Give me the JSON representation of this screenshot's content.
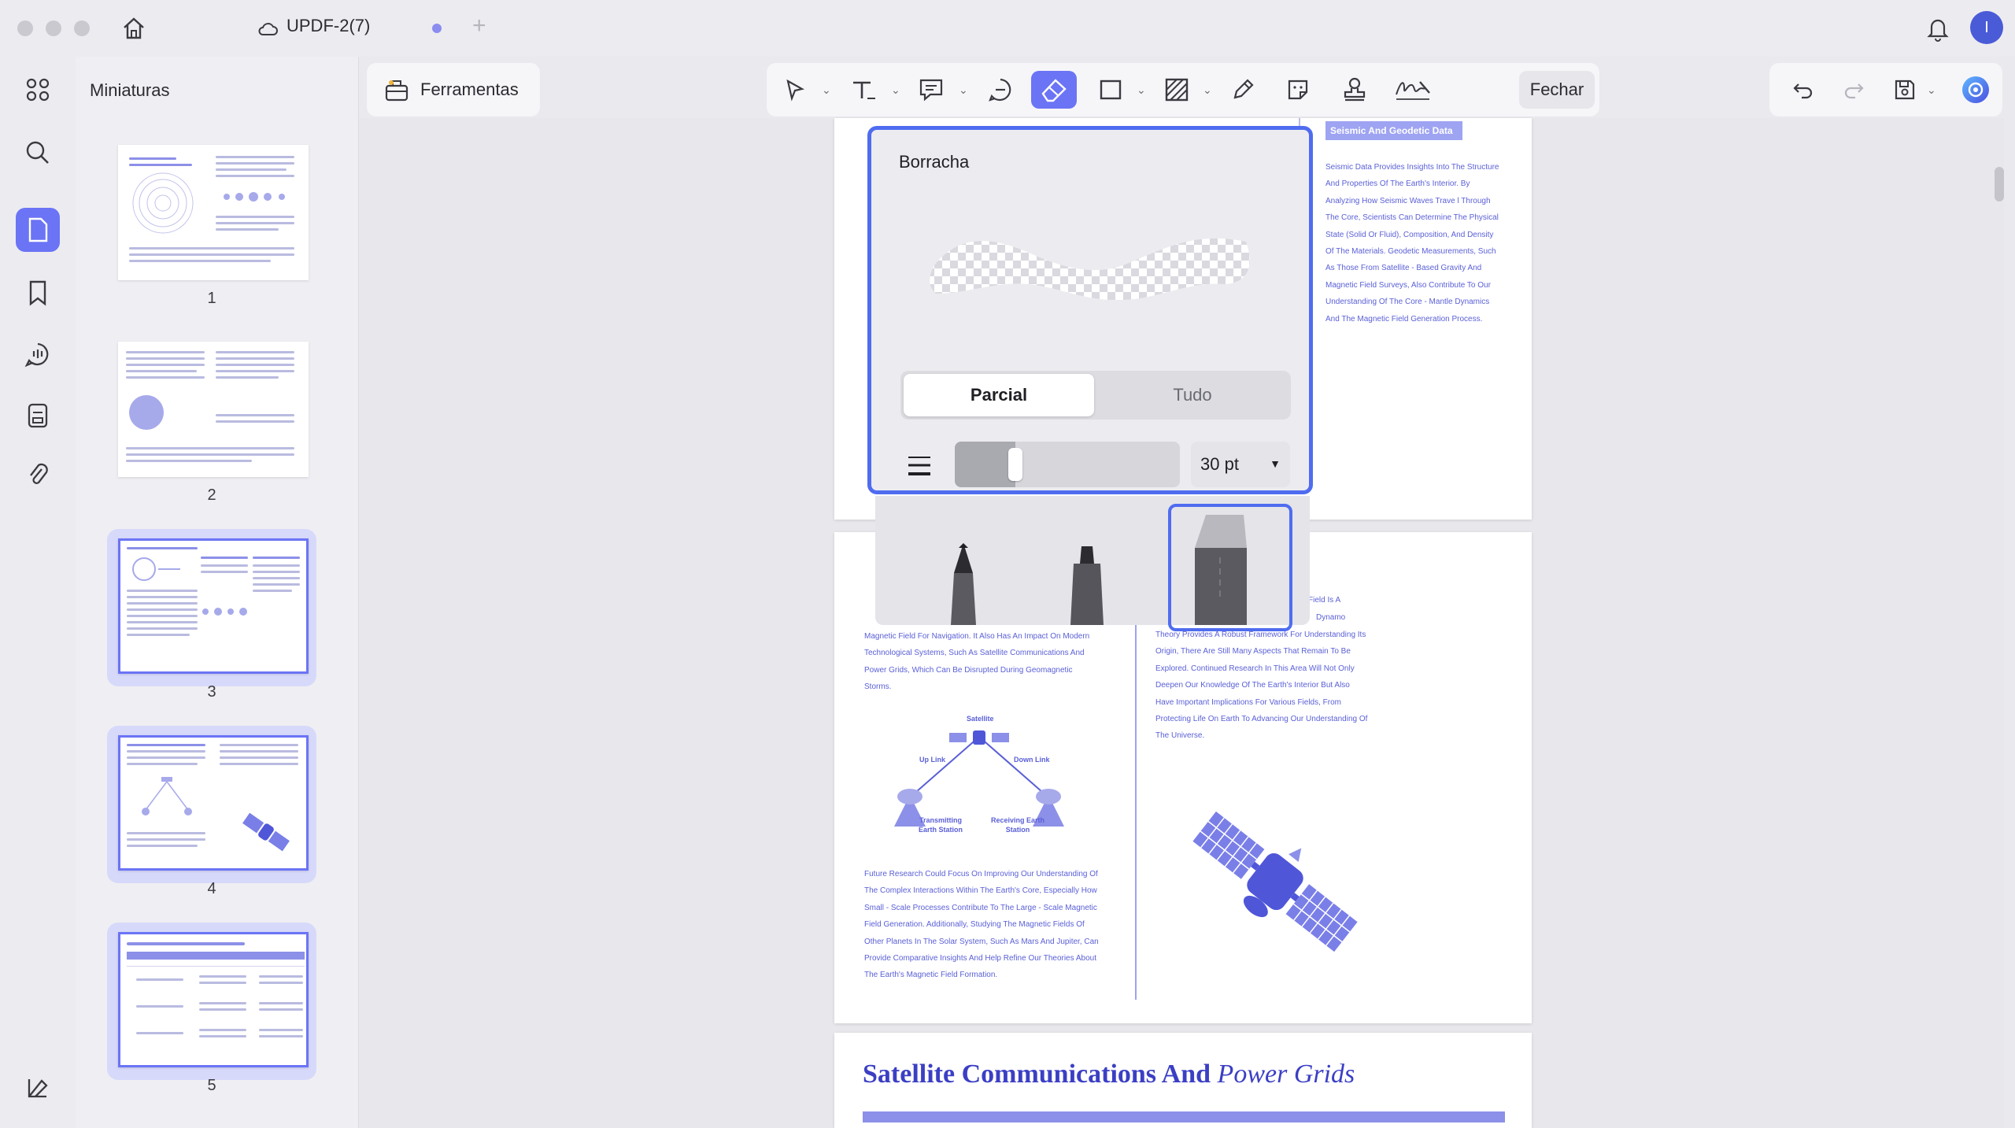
{
  "window": {
    "title": "UPDF-2(7)",
    "new_tab": "+",
    "user_initial": "I"
  },
  "sidebar": {
    "title": "Miniaturas",
    "rail_icons": [
      "thumbnails-grid-icon",
      "search-icon",
      "pages-icon",
      "bookmark-icon",
      "comment-icon",
      "form-icon",
      "attachment-icon",
      "layers-icon"
    ],
    "pages": [
      {
        "number": "1"
      },
      {
        "number": "2"
      },
      {
        "number": "3"
      },
      {
        "number": "4"
      },
      {
        "number": "5"
      }
    ]
  },
  "toolbar": {
    "tools_label": "Ferramentas",
    "close_label": "Fechar",
    "icons": [
      "cursor-icon",
      "text-icon",
      "text-comment-icon",
      "note-icon",
      "eraser-icon",
      "rectangle-icon",
      "hatch-icon",
      "pencil-icon",
      "sticker-icon",
      "stamp-icon",
      "signature-icon"
    ]
  },
  "eraser_popup": {
    "title": "Borracha",
    "mode_partial": "Parcial",
    "mode_all": "Tudo",
    "size": "30 pt",
    "size_fraction": 0.27,
    "tray_icons": [
      "pen-icon",
      "marker-icon",
      "eraser-tool-icon"
    ]
  },
  "document": {
    "seismic_badge": "Seismic And Geodetic Data",
    "seismic_text": "Seismic Data Provides Insights Into The Structure And Properties Of The Earth's Interior. By Analyzing How Seismic Waves Trave l Through The Core, Scientists Can Determine The Physical State (Solid Or Fluid), Composition, And Density Of The Materials. Geodetic Measurements, Such As Those From Satellite - Based Gravity And Magnetic Field Surveys, Also Contribute To Our Understanding Of The Core - Mantle Dynamics And The Magnetic Field Generation Process.",
    "left_col_top": "Magnetic Field For Navigation. It Also Has An Impact On Modern Technological Systems, Such As Satellite Communications And Power Grids, Which Can Be Disrupted During Geomagnetic Storms.",
    "right_col_top_a": "Field Is A",
    "right_col_top_b": "Dynamo",
    "right_col_text": "Theory Provides A Robust Framework For Understanding Its Origin, There Are Still Many Aspects That Remain To Be Explored. Continued Research In This Area Will Not Only Deepen Our Knowledge Of The Earth's Interior But Also Have Important Implications For Various Fields, From Protecting Life On Earth To Advancing Our Understanding Of The Universe.",
    "diagram": {
      "satellite": "Satellite",
      "up_link": "Up Link",
      "down_link": "Down Link",
      "tx": "Transmitting Earth Station",
      "rx": "Receiving Earth Station"
    },
    "future_text": "Future Research Could Focus On Improving Our Understanding Of The Complex Interactions Within The Earth's Core, Especially How Small - Scale Processes Contribute To The Large - Scale Magnetic Field Generation. Additionally, Studying The Magnetic Fields Of Other Planets In The Solar System, Such As Mars And Jupiter, Can Provide Comparative Insights And Help Refine Our Theories About The Earth's Magnetic Field Formation.",
    "section_title_bold": "Satellite Communications And",
    "section_title_italic": "Power Grids",
    "accent": "#6b74f5"
  }
}
